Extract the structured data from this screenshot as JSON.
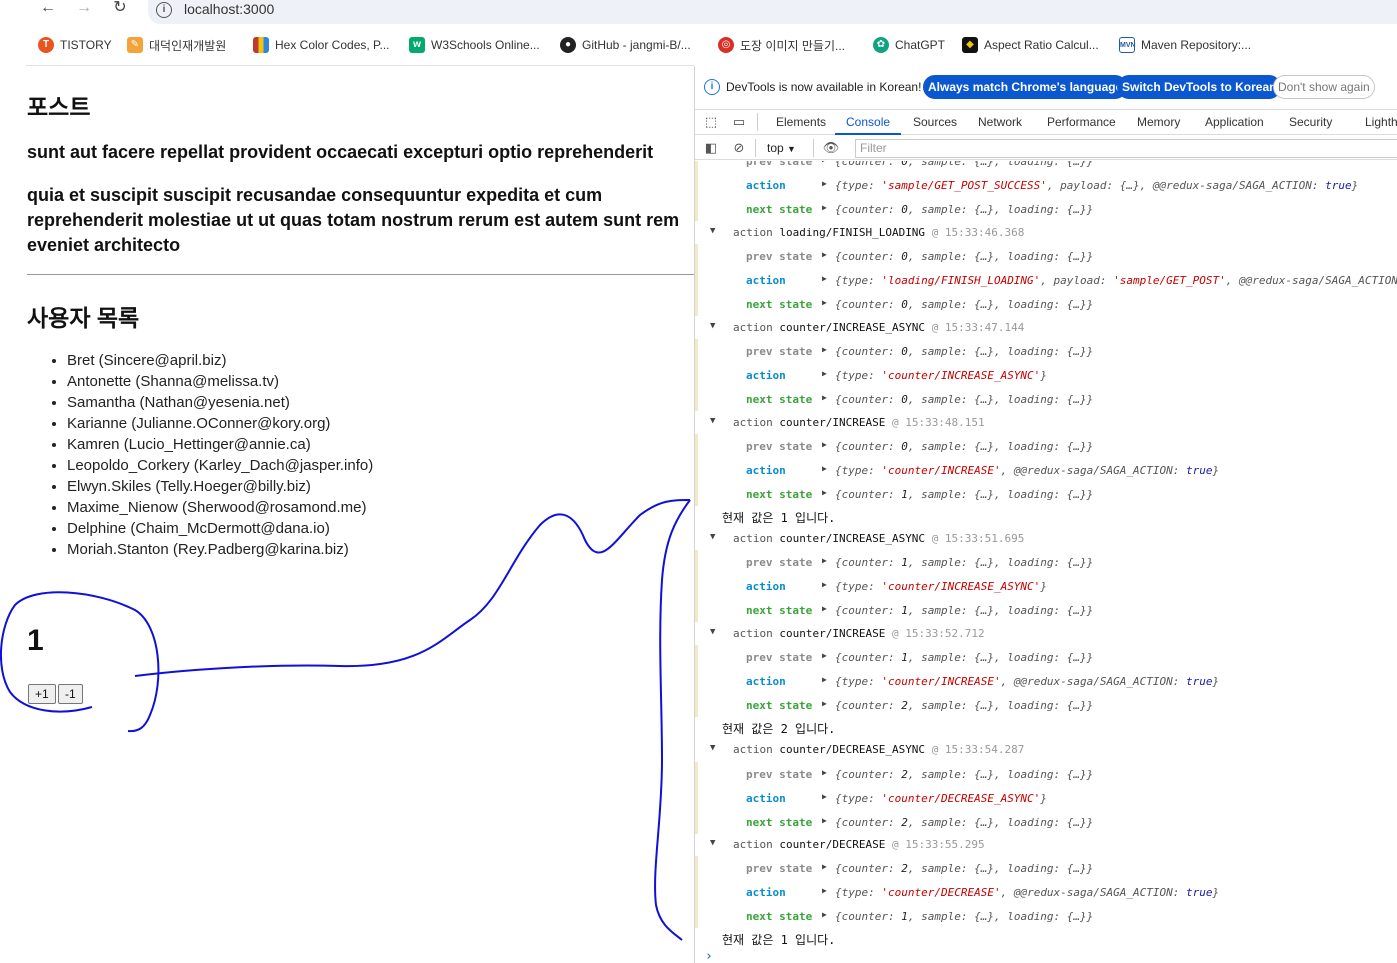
{
  "browser": {
    "url": "localhost:3000",
    "bookmarks": [
      {
        "label": "TISTORY",
        "icon": "tistory-icon",
        "color": "#eb531f"
      },
      {
        "label": "대덕인재개발원",
        "icon": "pen-icon",
        "color": "#f2a33a"
      },
      {
        "label": "Hex Color Codes, P...",
        "icon": "color-book-icon",
        "color": "#c0392b"
      },
      {
        "label": "W3Schools Online...",
        "icon": "w3schools-icon",
        "color": "#04aa6d"
      },
      {
        "label": "GitHub - jangmi-B/...",
        "icon": "github-icon",
        "color": "#222222"
      },
      {
        "label": "도장 이미지 만들기...",
        "icon": "stamp-icon",
        "color": "#d93025"
      },
      {
        "label": "ChatGPT",
        "icon": "chatgpt-icon",
        "color": "#10a37f"
      },
      {
        "label": "Aspect Ratio Calcul...",
        "icon": "aspect-icon",
        "color": "#f1c40f"
      },
      {
        "label": "Maven Repository:...",
        "icon": "maven-icon",
        "color": "#1f5aa6"
      }
    ]
  },
  "page": {
    "post_heading": "포스트",
    "post_title": "sunt aut facere repellat provident occaecati excepturi optio reprehenderit",
    "post_body": "quia et suscipit suscipit recusandae consequuntur expedita et cum reprehenderit molestiae ut ut quas totam nostrum rerum est autem sunt rem eveniet architecto",
    "users_heading": "사용자 목록",
    "users": [
      "Bret (Sincere@april.biz)",
      "Antonette (Shanna@melissa.tv)",
      "Samantha (Nathan@yesenia.net)",
      "Karianne (Julianne.OConner@kory.org)",
      "Kamren (Lucio_Hettinger@annie.ca)",
      "Leopoldo_Corkery (Karley_Dach@jasper.info)",
      "Elwyn.Skiles (Telly.Hoeger@billy.biz)",
      "Maxime_Nienow (Sherwood@rosamond.me)",
      "Delphine (Chaim_McDermott@dana.io)",
      "Moriah.Stanton (Rey.Padberg@karina.biz)"
    ],
    "counter_value": "1",
    "increase_label": "+1",
    "decrease_label": "-1"
  },
  "devtools": {
    "info_message": "DevTools is now available in Korean!",
    "btn_always_match": "Always match Chrome's language",
    "btn_switch": "Switch DevTools to Korean",
    "btn_dont_show": "Don't show again",
    "tabs": [
      "Elements",
      "Console",
      "Sources",
      "Network",
      "Performance",
      "Memory",
      "Application",
      "Security",
      "Lighth"
    ],
    "active_tab": "Console",
    "context": "top",
    "filter_placeholder": "Filter",
    "labels": {
      "prev": "prev state",
      "action": "action",
      "next": "next state"
    },
    "state_text": {
      "s0": "{counter: 0, sample: {…}, loading: {…}}",
      "s1": "{counter: 1, sample: {…}, loading: {…}}",
      "s2": "{counter: 2, sample: {…}, loading: {…}}"
    },
    "actions": {
      "get_post_success": "{type: 'sample/GET_POST_SUCCESS', payload: {…}, @@redux-saga/SAGA_ACTION: true}",
      "finish_loading": "{type: 'loading/FINISH_LOADING', payload: 'sample/GET_POST', @@redux-saga/SAGA_ACTION",
      "increase_async": "{type: 'counter/INCREASE_ASYNC'}",
      "increase": "{type: 'counter/INCREASE', @@redux-saga/SAGA_ACTION: true}",
      "decrease_async": "{type: 'counter/DECREASE_ASYNC'}",
      "decrease": "{type: 'counter/DECREASE', @@redux-saga/SAGA_ACTION: true}"
    },
    "groups": [
      {
        "prefix": "action ",
        "name": "loading/FINISH_LOADING",
        "time": "@ 15:33:46.368"
      },
      {
        "prefix": "action ",
        "name": "counter/INCREASE_ASYNC",
        "time": "@ 15:33:47.144"
      },
      {
        "prefix": "action ",
        "name": "counter/INCREASE",
        "time": "@ 15:33:48.151"
      },
      {
        "prefix": "action ",
        "name": "counter/INCREASE_ASYNC",
        "time": "@ 15:33:51.695"
      },
      {
        "prefix": "action ",
        "name": "counter/INCREASE",
        "time": "@ 15:33:52.712"
      },
      {
        "prefix": "action ",
        "name": "counter/DECREASE_ASYNC",
        "time": "@ 15:33:54.287"
      },
      {
        "prefix": "action ",
        "name": "counter/DECREASE",
        "time": "@ 15:33:55.295"
      }
    ],
    "logs": [
      "현재 값은 1 입니다.",
      "현재 값은 2 입니다.",
      "현재 값은 1 입니다."
    ]
  },
  "colors": {
    "accent": "#0b57d0",
    "scribble": "#1010d8",
    "action_label": "#0a8dcf",
    "next_label": "#3aa43a",
    "string": "#c80000"
  }
}
